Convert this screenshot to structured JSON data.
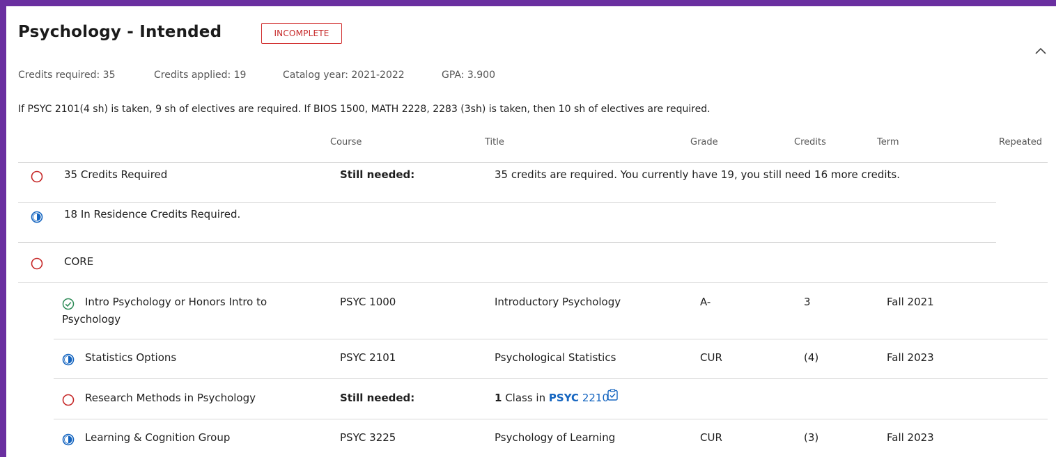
{
  "block": {
    "title": "Psychology  -  Intended",
    "status_badge": "INCOMPLETE",
    "meta": {
      "credits_required": "Credits required:  35",
      "credits_applied": "Credits applied:  19",
      "catalog_year": "Catalog year:  2021-2022",
      "gpa": "GPA:  3.900"
    },
    "note": "If PSYC 2101(4 sh) is taken, 9 sh of electives are required. If BIOS 1500, MATH 2228, 2283 (3sh) is taken, then 10 sh of electives are required."
  },
  "table": {
    "columns": {
      "course": "Course",
      "title": "Title",
      "grade": "Grade",
      "credits": "Credits",
      "term": "Term",
      "repeated": "Repeated"
    },
    "rows": [
      {
        "status": "not-started",
        "requirement": "35 Credits Required",
        "course": "Still needed:",
        "title": "35 credits are required. You currently have 19, you still need 16 more credits."
      },
      {
        "status": "in-progress",
        "requirement": "18 In Residence Credits Required."
      },
      {
        "status": "not-started",
        "requirement": "CORE"
      },
      {
        "status": "complete",
        "requirement_line1": "Intro Psychology or Honors Intro to",
        "requirement_line2": "Psychology",
        "course": "PSYC 1000",
        "title": "Introductory Psychology",
        "grade": "A-",
        "credits": "3",
        "term": "Fall 2021"
      },
      {
        "status": "in-progress",
        "requirement": "Statistics Options",
        "course": "PSYC 2101",
        "title": "Psychological Statistics",
        "grade": "CUR",
        "credits": "(4)",
        "term": "Fall 2023"
      },
      {
        "status": "not-started",
        "requirement": "Research Methods in Psychology",
        "course": "Still needed:",
        "needed_count": "1",
        "needed_text": " Class in ",
        "needed_subject": "PSYC",
        "needed_number": "2210"
      },
      {
        "status": "in-progress",
        "requirement": "Learning & Cognition Group",
        "course": "PSYC 3225",
        "title": "Psychology of Learning",
        "grade": "CUR",
        "credits": "(3)",
        "term": "Fall 2023"
      }
    ]
  },
  "colors": {
    "frame": "#6a2fa0",
    "incomplete": "#c62828",
    "complete": "#2e8b57",
    "in_progress": "#1565c0",
    "link": "#1565c0"
  },
  "icons": [
    "chevron-up-icon",
    "circle-outline-icon",
    "half-circle-icon",
    "check-circle-icon",
    "course-info-icon"
  ]
}
